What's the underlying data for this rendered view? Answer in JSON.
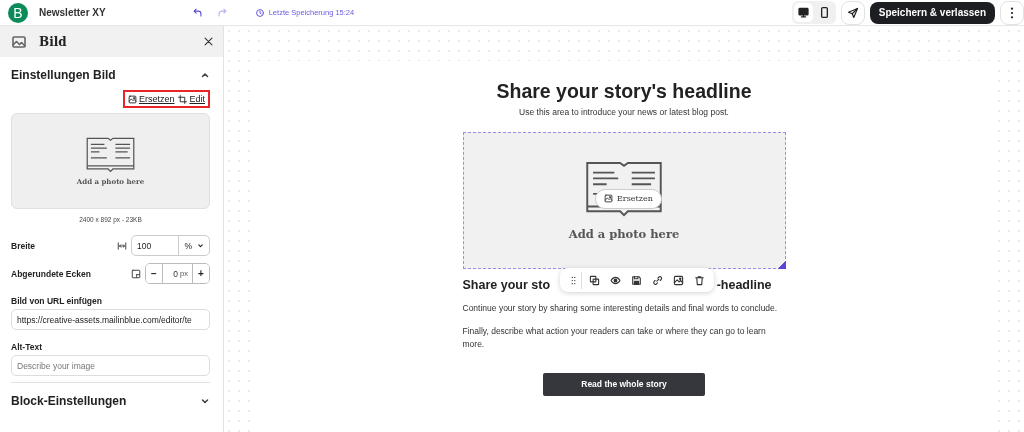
{
  "header": {
    "logo": "B",
    "title": "Newsletter XY",
    "last_saved": "Letzte Speicherung 15:24",
    "view_modes": [
      {
        "kind": "desktop",
        "selected": true
      },
      {
        "kind": "mobile",
        "selected": false
      }
    ],
    "save_button": "Speichern & verlassen"
  },
  "sidebar": {
    "title": "Bild",
    "settings_section": {
      "title": "Einstellungen Bild",
      "expanded": true
    },
    "image_actions": {
      "highlighted": true,
      "items": [
        {
          "kind": "replace",
          "label": "Ersetzen"
        },
        {
          "kind": "edit",
          "label": "Edit"
        }
      ]
    },
    "image_preview": {
      "caption": "Add a photo here"
    },
    "image_info": "2400 x 892 px - 23KB",
    "width": {
      "label": "Breite",
      "value": "100",
      "unit": "%"
    },
    "corners": {
      "label": "Abgerundete Ecken",
      "decrement": "−",
      "value": "0",
      "unit": "px",
      "increment": "+"
    },
    "url_field": {
      "label": "Bild von URL einfügen",
      "value": "https://creative-assets.mailinblue.com/editor/te"
    },
    "alt_field": {
      "label": "Alt-Text",
      "placeholder": "Describe your image"
    },
    "block_section": {
      "title": "Block-Einstellungen",
      "expanded": false
    }
  },
  "email": {
    "headline": "Share your story's headline",
    "intro": "Use this area to introduce your news or latest blog post.",
    "image": {
      "caption": "Add a photo here",
      "replace_label": "Ersetzen",
      "selected": true
    },
    "toolbar": [
      {
        "kind": "drag"
      },
      {
        "kind": "duplicate"
      },
      {
        "kind": "preview"
      },
      {
        "kind": "save"
      },
      {
        "kind": "link"
      },
      {
        "kind": "image"
      },
      {
        "kind": "delete"
      }
    ],
    "subheadline_start": "Share your sto",
    "subheadline_end": "-headline",
    "paragraphs": [
      "Continue your story by sharing some interesting details and final words to conclude.",
      "Finally, describe what action your readers can take or where they can go to learn more."
    ],
    "cta": "Read the whole story"
  }
}
